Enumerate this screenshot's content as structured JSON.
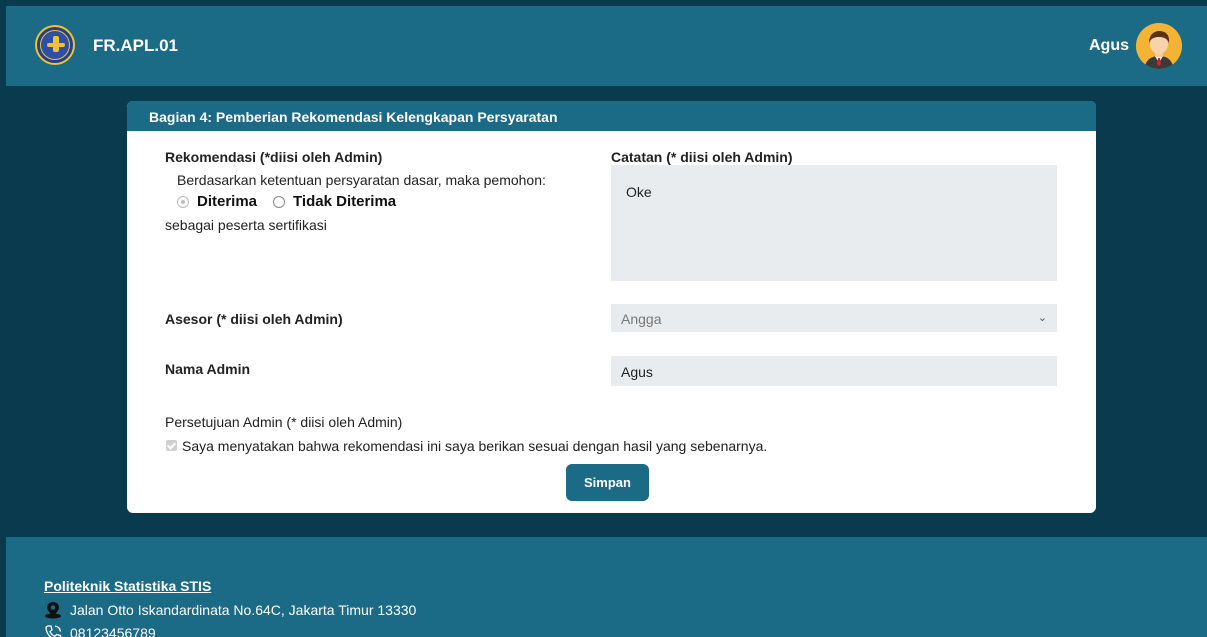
{
  "header": {
    "title": "FR.APL.01",
    "username": "Agus",
    "logo_text": "STIS"
  },
  "card": {
    "header": "Bagian 4: Pemberian Rekomendasi Kelengkapan Persyaratan",
    "rekomendasi_label": "Rekomendasi (*diisi oleh Admin)",
    "rekomendasi_intro": "Berdasarkan ketentuan persyaratan dasar, maka pemohon:",
    "options": [
      "Diterima",
      "Tidak Diterima"
    ],
    "selected_option": "Diterima",
    "suffix": "sebagai peserta sertifikasi",
    "catatan_label": "Catatan (* diisi oleh Admin)",
    "catatan_value": "Oke",
    "asesor_label": "Asesor (* diisi oleh Admin)",
    "asesor_value": "Angga",
    "nama_admin_label": "Nama Admin",
    "nama_admin_value": "Agus",
    "persetujuan_label": "Persetujuan Admin (* diisi oleh Admin)",
    "persetujuan_statement": "Saya menyatakan bahwa rekomendasi ini saya berikan sesuai dengan hasil yang sebenarnya.",
    "persetujuan_checked": true,
    "submit_label": "Simpan"
  },
  "footer": {
    "name": "Politeknik Statistika STIS",
    "address": "Jalan Otto Iskandardinata No.64C, Jakarta Timur 13330",
    "phone": "08123456789"
  },
  "colors": {
    "primary": "#1b6a86",
    "background": "#0a3a4d",
    "field": "#e9ecef"
  }
}
